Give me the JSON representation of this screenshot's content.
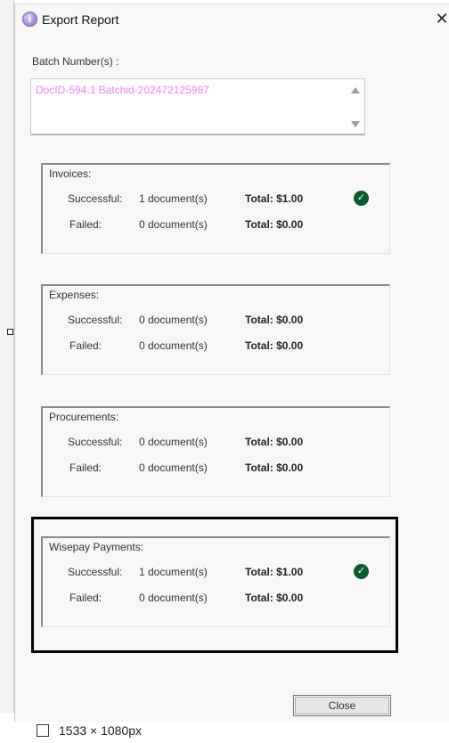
{
  "window": {
    "title": "Export Report",
    "close_glyph": "✕"
  },
  "batch": {
    "label": "Batch Number(s) :",
    "value": "DocID-594.1 Batchid-202472125987"
  },
  "groups": [
    {
      "title": "Invoices:",
      "rows": [
        {
          "label": "Successful:",
          "docs": "1 document(s)",
          "total": "Total: $1.00",
          "status": "success"
        },
        {
          "label": "Failed:",
          "docs": "0 document(s)",
          "total": "Total: $0.00"
        }
      ]
    },
    {
      "title": "Expenses:",
      "rows": [
        {
          "label": "Successful:",
          "docs": "0 document(s)",
          "total": "Total: $0.00"
        },
        {
          "label": "Failed:",
          "docs": "0 document(s)",
          "total": "Total: $0.00"
        }
      ]
    },
    {
      "title": "Procurements:",
      "rows": [
        {
          "label": "Successful:",
          "docs": "0 document(s)",
          "total": "Total: $0.00"
        },
        {
          "label": "Failed:",
          "docs": "0 document(s)",
          "total": "Total: $0.00"
        }
      ]
    },
    {
      "title": "Wisepay Payments:",
      "rows": [
        {
          "label": "Successful:",
          "docs": "1 document(s)",
          "total": "Total: $1.00",
          "status": "success"
        },
        {
          "label": "Failed:",
          "docs": "0 document(s)",
          "total": "Total: $0.00"
        }
      ]
    }
  ],
  "buttons": {
    "close": "Close"
  },
  "footer": {
    "dimensions": "1533 × 1080px"
  },
  "colors": {
    "batch_text": "#ee82ee",
    "check_green": "#0b5a2d",
    "highlight_border": "#000000"
  },
  "icons": {
    "title": "info-icon",
    "success": "check-circle-icon",
    "close": "close-icon"
  }
}
